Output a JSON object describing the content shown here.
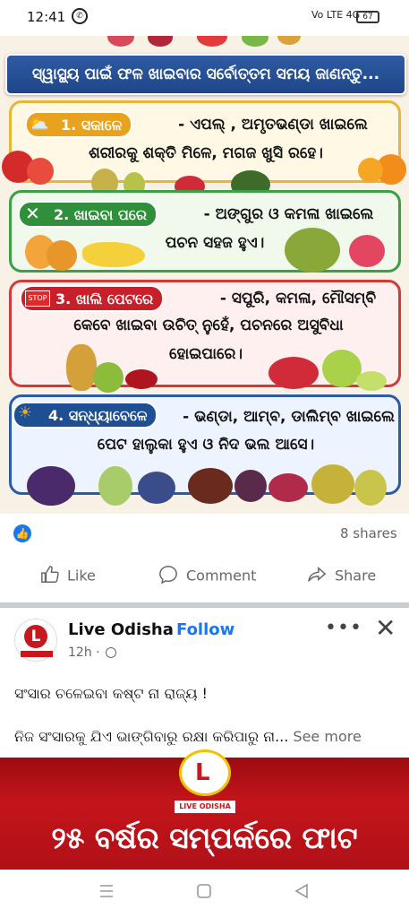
{
  "status_bar": {
    "time": "12:41",
    "whatsapp_icon": "whatsapp-icon",
    "network": "Vo LTE 4G",
    "battery": "67"
  },
  "post_image": {
    "banner": "ସ୍ୱାସ୍ଥ୍ୟ ପାଇଁ ଫଳ ଖାଇବାର ସର୍ବୋତ୍ତମ ସମୟ ଜାଣନ୍ତୁ...",
    "sections": [
      {
        "label": "1. ସକାଳେ",
        "line1": "- ଏପଲ୍ , ଅମୃତଭଣ୍ଡା ଖାଇଲେ",
        "line2": "ଶରୀରକୁ ଶକ୍ତି ମିଳେ, ମଗଜ ଖୁସି ରହେ।",
        "color": "#e8a21d"
      },
      {
        "label": "2. ଖାଇବା ପରେ",
        "line1": "- ଅଙ୍ଗୁର ଓ କମଳା ଖାଇଲେ",
        "line2": "ପଚନ ସହଜ ହୁଏ।",
        "color": "#2f8f3a"
      },
      {
        "label": "3. ଖାଲି ପେଟରେ",
        "line1": "- ସପୁରି, କମଳା, ମୌସମ୍ବି",
        "line2": "କେବେ ଖାଇବା ଉଚିତ୍ ନୁହେଁ, ପଚନରେ ଅସୁବିଧା",
        "line3": "ହୋଇପାରେ।",
        "color": "#c8202a"
      },
      {
        "label": "4. ସନ୍ଧ୍ୟାବେଳେ",
        "line1": "- ଭଣ୍ଡା, ଆମ୍ବ, ଡାଲିମ୍ବ ଖାଇଲେ",
        "line2": "ପେଟ ହାଲୁକା ହୁଏ ଓ ନିଦ ଭଲ ଆସେ।",
        "color": "#1f4f93"
      }
    ]
  },
  "reactions": {
    "shares": "8 shares",
    "like_label": "Like",
    "comment_label": "Comment",
    "share_label": "Share"
  },
  "next_post": {
    "page_name": "Live Odisha",
    "separator": "·",
    "follow_label": "Follow",
    "time": "12h ·",
    "more": "•••",
    "close": "✕",
    "caption_line1": "ସଂସାର ଚଳେଇବା କଷ୍ଟ ନା ରାଜ୍ୟ !",
    "caption_line2": "ନିଜ ସଂସାରକୁ ଯିଏ ଭାଙ୍ଗିବାରୁ ରକ୍ଷା କରିପାରୁ ନା...",
    "see_more": " See more",
    "logo_text": "LIVE ODISHA",
    "headline": "୨୫ ବର୍ଷର ସମ୍ପର୍କରେ ଫାଟ",
    "logo_letter": "L"
  },
  "nav": {
    "menu_icon": "recent-apps-icon",
    "home_icon": "home-icon",
    "back_icon": "back-icon"
  },
  "colors": {
    "facebook_blue": "#1877f2",
    "banner_blue": "#2f5ba3",
    "live_red": "#c8171e"
  }
}
